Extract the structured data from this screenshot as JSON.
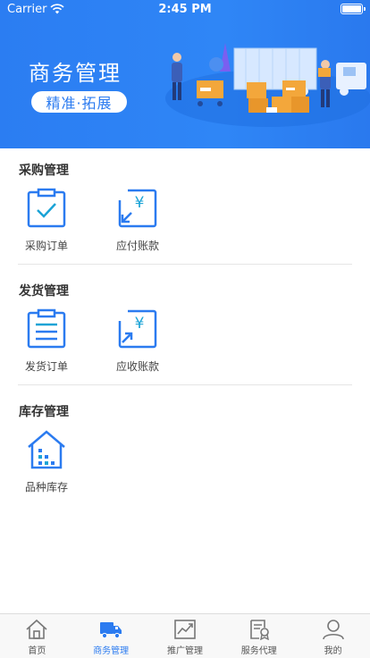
{
  "status_bar": {
    "carrier": "Carrier",
    "time": "2:45 PM"
  },
  "banner": {
    "title": "商务管理",
    "subtitle": "精准·拓展"
  },
  "sections": [
    {
      "title": "采购管理",
      "items": [
        {
          "label": "采购订单",
          "icon": "clipboard-check-icon"
        },
        {
          "label": "应付账款",
          "icon": "yen-arrow-in-icon"
        }
      ]
    },
    {
      "title": "发货管理",
      "items": [
        {
          "label": "发货订单",
          "icon": "clipboard-list-icon"
        },
        {
          "label": "应收账款",
          "icon": "yen-arrow-out-icon"
        }
      ]
    },
    {
      "title": "库存管理",
      "items": [
        {
          "label": "品种库存",
          "icon": "warehouse-icon"
        }
      ]
    }
  ],
  "tabbar": {
    "active_index": 1,
    "tabs": [
      {
        "label": "首页",
        "icon": "home-icon"
      },
      {
        "label": "商务管理",
        "icon": "truck-icon"
      },
      {
        "label": "推广管理",
        "icon": "trend-chart-icon"
      },
      {
        "label": "服务代理",
        "icon": "document-badge-icon"
      },
      {
        "label": "我的",
        "icon": "user-icon"
      }
    ]
  },
  "colors": {
    "accent": "#2b7bf0",
    "banner": "#2f86f6",
    "icon_teal": "#1aa3d6"
  }
}
